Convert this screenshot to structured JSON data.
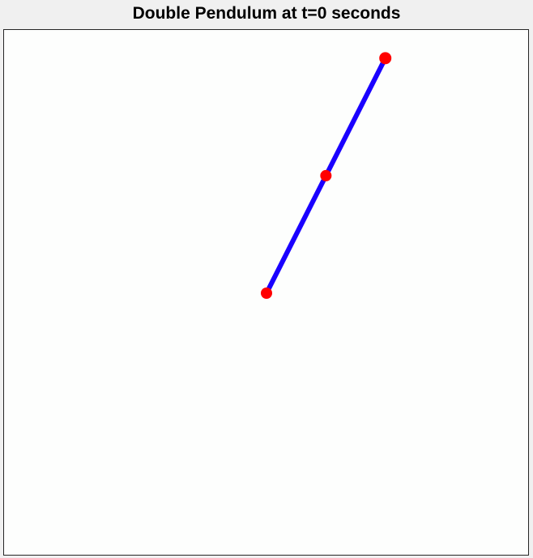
{
  "figure": {
    "title": "Double Pendulum at t=0 seconds"
  },
  "chart_data": {
    "type": "line",
    "title": "Double Pendulum at t=0 seconds",
    "xlim": [
      -2,
      2
    ],
    "ylim": [
      -2,
      2
    ],
    "grid": false,
    "axes_visible": false,
    "rod_color": "#1a00ff",
    "bob_color": "#ff0000",
    "points": [
      {
        "name": "pivot",
        "x": 0.0,
        "y": 0.0
      },
      {
        "name": "bob1",
        "x": 0.45,
        "y": 0.89
      },
      {
        "name": "bob2",
        "x": 0.9,
        "y": 1.78
      }
    ]
  }
}
